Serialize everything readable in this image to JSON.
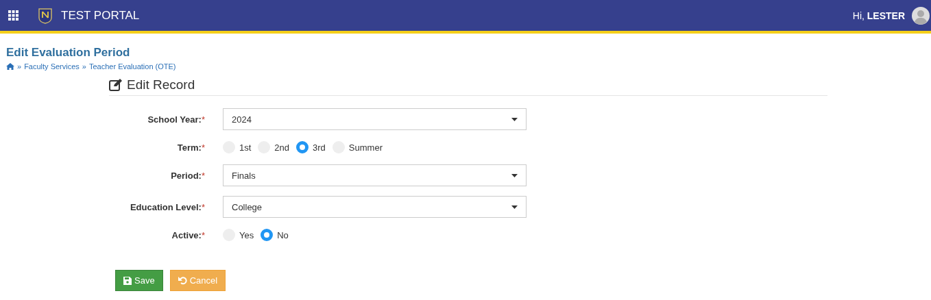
{
  "header": {
    "app_title": "TEST PORTAL",
    "greeting": "Hi, ",
    "user_name": "LESTER"
  },
  "page_title": "Edit Evaluation Period",
  "breadcrumb": [
    {
      "separator": "»",
      "label": "Faculty Services"
    },
    {
      "separator": "»",
      "label": "Teacher Evaluation (OTE)"
    }
  ],
  "form": {
    "heading": "Edit Record",
    "fields": [
      {
        "kind": "select",
        "label": "School Year:",
        "required_mark": "*",
        "value": "2024"
      },
      {
        "kind": "radio",
        "label": "Term:",
        "required_mark": "*",
        "options": [
          {
            "label": "1st",
            "selected": false
          },
          {
            "label": "2nd",
            "selected": false
          },
          {
            "label": "3rd",
            "selected": true
          },
          {
            "label": "Summer",
            "selected": false
          }
        ]
      },
      {
        "kind": "select",
        "label": "Period:",
        "required_mark": "*",
        "value": "Finals"
      },
      {
        "kind": "select",
        "label": "Education Level:",
        "required_mark": "*",
        "value": "College"
      },
      {
        "kind": "radio",
        "label": "Active:",
        "required_mark": "*",
        "options": [
          {
            "label": "Yes",
            "selected": false
          },
          {
            "label": "No",
            "selected": true
          }
        ]
      }
    ]
  },
  "buttons": [
    {
      "kind": "save",
      "label": "Save"
    },
    {
      "kind": "cancel",
      "label": "Cancel"
    }
  ]
}
